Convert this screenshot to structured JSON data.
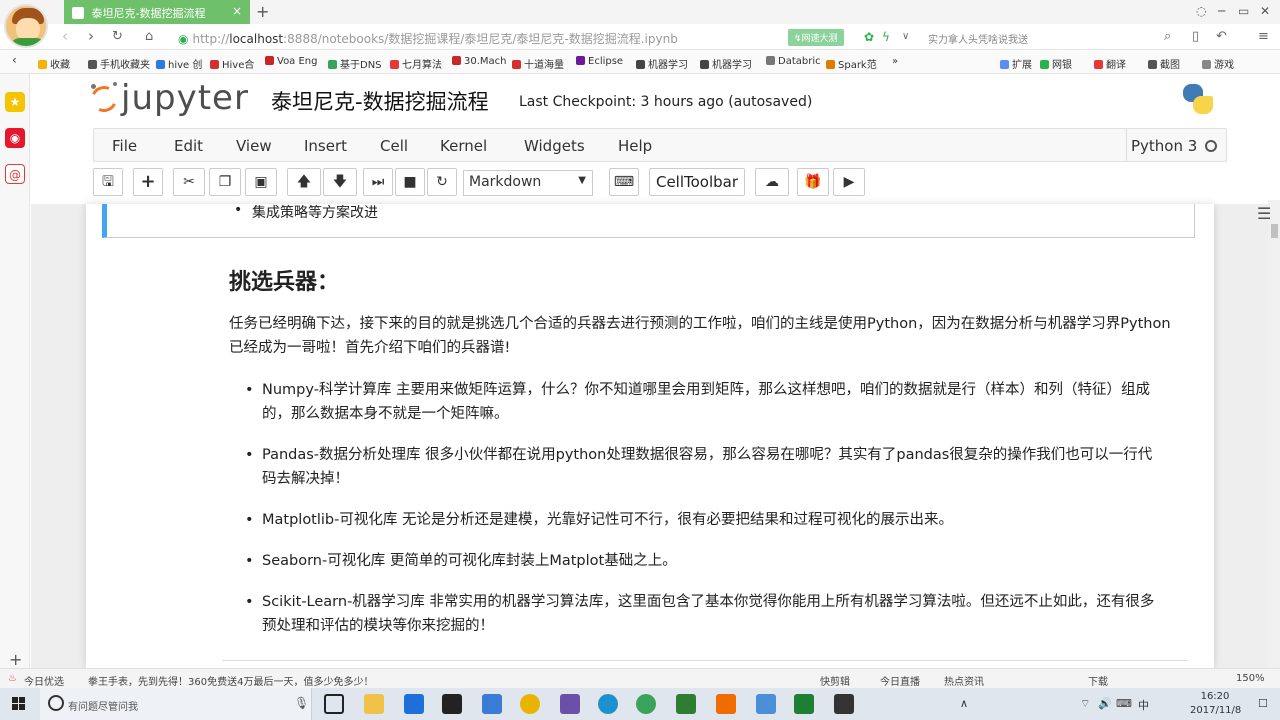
{
  "browser": {
    "tab_title": "泰坦尼克-数据挖掘流程",
    "tab_close": "×",
    "new_tab": "+",
    "url_scheme": "http://",
    "url_host": "localhost",
    "url_path": ":8888/notebooks/数据挖掘课程/泰坦尼克/泰坦尼克-数据挖掘流程.ipynb",
    "speed_badge": "↯网速大测",
    "news_text": "实力拿人头凭啥说我送",
    "bookmarks": [
      "收藏",
      "手机收藏夹",
      "hive 创",
      "Hive合",
      "Voa Eng",
      "基于DNS",
      "七月算法",
      "30.Mach",
      "十道海量",
      "Eclipse",
      "机器学习",
      "机器学习",
      "Databric",
      "Spark范",
      "»"
    ],
    "bookmark_colors": [
      "#f5b400",
      "#555555",
      "#2a7ae2",
      "#d32f2f",
      "#c62828",
      "#3aa35b",
      "#e53935",
      "#c62828",
      "#d32f2f",
      "#6a1b9a",
      "#444444",
      "#444444",
      "#777777",
      "#e07b00",
      "#333333"
    ],
    "right_tools": [
      "扩展",
      "网银",
      "翻译",
      "截图",
      "游戏"
    ]
  },
  "jupyter": {
    "logo_text": "jupyter",
    "notebook_title": "泰坦尼克-数据挖掘流程",
    "checkpoint": "Last Checkpoint: 3 hours ago (autosaved)",
    "menu": [
      "File",
      "Edit",
      "View",
      "Insert",
      "Cell",
      "Kernel",
      "Widgets",
      "Help"
    ],
    "kernel_name": "Python 3",
    "cell_type": "Markdown",
    "celltoolbar_label": "CellToolbar"
  },
  "content": {
    "prev_bullet": "集成策略等方案改进",
    "heading": "挑选兵器：",
    "intro": "任务已经明确下达，接下来的目的就是挑选几个合适的兵器去进行预测的工作啦，咱们的主线是使用Python，因为在数据分析与机器学习界Python已经成为一哥啦！首先介绍下咱们的兵器谱!",
    "items": [
      "Numpy-科学计算库 主要用来做矩阵运算，什么？你不知道哪里会用到矩阵，那么这样想吧，咱们的数据就是行（样本）和列（特征）组成的，那么数据本身不就是一个矩阵嘛。",
      "Pandas-数据分析处理库 很多小伙伴都在说用python处理数据很容易，那么容易在哪呢？其实有了pandas很复杂的操作我们也可以一行代码去解决掉！",
      "Matplotlib-可视化库 无论是分析还是建模，光靠好记性可不行，很有必要把结果和过程可视化的展示出来。",
      "Seaborn-可视化库 更简单的可视化库封装上Matplot基础之上。",
      "Scikit-Learn-机器学习库 非常实用的机器学习算法库，这里面包含了基本你觉得你能用上所有机器学习算法啦。但还远不止如此，还有很多预处理和评估的模块等你来挖掘的！"
    ]
  },
  "statusbar": {
    "left1": "今日优选",
    "left2": "拳王手表，先到先得！360免费送4万最后一天，值多少免多少！",
    "right": [
      "快剪辑",
      "今日直播",
      "热点资讯",
      "下载",
      "150%"
    ]
  },
  "taskbar": {
    "search_placeholder": "有问题尽管问我",
    "tray_lang": "中",
    "time": "16:20",
    "date": "2017/11/8"
  }
}
